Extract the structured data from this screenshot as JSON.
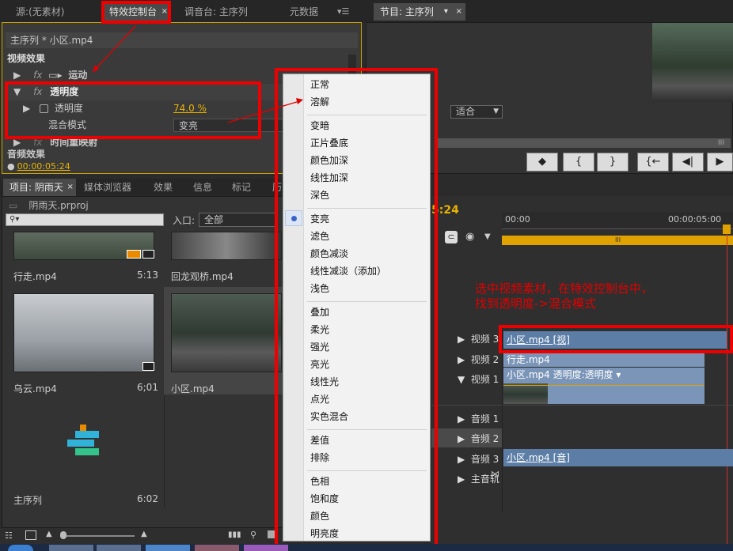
{
  "top_tabs": {
    "source": "源:(无素材)",
    "effect_controls": "特效控制台",
    "audio_mixer": "调音台: 主序列",
    "metadata": "元数据",
    "program": "节目: 主序列"
  },
  "effect_controls": {
    "clip_path": "主序列 * 小区.mp4",
    "video_effects": "视频效果",
    "motion": "运动",
    "opacity_group": "透明度",
    "opacity_label": "透明度",
    "opacity_value": "74.0 %",
    "blend_label": "混合模式",
    "blend_value": "变亮",
    "time_remap": "时间重映射",
    "audio_effects": "音频效果",
    "timecode": "00:00:05:24",
    "fx": "fx"
  },
  "program_monitor": {
    "fit": "适合",
    "timecode_partial": "5",
    "transport": [
      "◆",
      "{",
      "}",
      "{←",
      "◀|",
      "▶"
    ]
  },
  "project": {
    "tabs": [
      "项目: 阴雨天",
      "媒体浏览器",
      "效果",
      "信息",
      "标记",
      "历"
    ],
    "file": "阴雨天.prproj",
    "in_label": "入口:",
    "in_value": "全部",
    "items": [
      {
        "name": "行走.mp4",
        "dur": "5:13"
      },
      {
        "name": "回龙观桥.mp4",
        "dur": ""
      },
      {
        "name": "乌云.mp4",
        "dur": "6;01"
      },
      {
        "name": "小区.mp4",
        "dur": ""
      },
      {
        "name": "主序列",
        "dur": "6:02"
      }
    ]
  },
  "timeline": {
    "timecode": "5:24",
    "ruler_start": "00:00",
    "ruler_end": "00:00:05:00",
    "ruler_mid": "III",
    "tracks": [
      {
        "name": "视频 3",
        "clip": "小区.mp4 [视]"
      },
      {
        "name": "视频 2",
        "clip": "行走.mp4"
      },
      {
        "name": "视频 1",
        "clip": "小区.mp4  透明度:透明度 ▾"
      },
      {
        "name": "音频 1",
        "clip": ""
      },
      {
        "name": "音频 2",
        "clip": ""
      },
      {
        "name": "音频 3",
        "clip": "小区.mp4 [音]"
      },
      {
        "name": "主音轨",
        "clip": ""
      }
    ],
    "annotation": "选中视频素材，在特效控制台中，\n找到透明度->混合模式"
  },
  "blend_menu": [
    [
      "正常",
      "溶解"
    ],
    [
      "变暗",
      "正片叠底",
      "颜色加深",
      "线性加深",
      "深色"
    ],
    [
      "变亮",
      "滤色",
      "颜色减淡",
      "线性减淡（添加）",
      "浅色"
    ],
    [
      "叠加",
      "柔光",
      "强光",
      "亮光",
      "线性光",
      "点光",
      "实色混合"
    ],
    [
      "差值",
      "排除"
    ],
    [
      "色相",
      "饱和度",
      "颜色",
      "明亮度"
    ]
  ],
  "colors": {
    "accent_orange": "#f0b400",
    "annotation_red": "#e00000",
    "clip_blue": "#5c7ea6"
  }
}
